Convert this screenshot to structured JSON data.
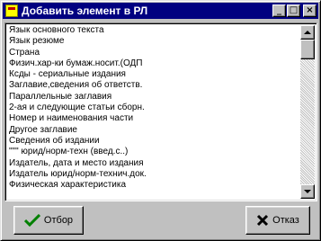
{
  "window": {
    "title": "Добавить элемент в РЛ",
    "minimize_glyph": "_",
    "maximize_glyph": "□",
    "close_glyph": "×"
  },
  "list": {
    "items": [
      "Язык основного текста",
      "Язык резюме",
      "Страна",
      "Физич.хар-ки бумаж.носит.(ОДП",
      "Ксды - сериальные издания",
      "Заглавие,сведения об ответств.",
      "Параллельные заглавия",
      "2-ая и следующие статьи сборн.",
      "Номер и наименования части",
      "Другое заглавие",
      "Сведения об издании",
      "\"\"\" юрид/норм-техн (введ.с..)",
      "Издатель, дата и место издания",
      "Издатель юрид/норм-технич.док.",
      "Физическая характеристика"
    ]
  },
  "buttons": {
    "ok_label": "Отбор",
    "ok_icon": "checkmark-icon",
    "cancel_label": "Отказ",
    "cancel_icon": "x-cross-icon"
  },
  "colors": {
    "titlebar": "#000080",
    "face": "#c0c0c0",
    "ok_check": "#008000",
    "cancel_x": "#000000"
  }
}
